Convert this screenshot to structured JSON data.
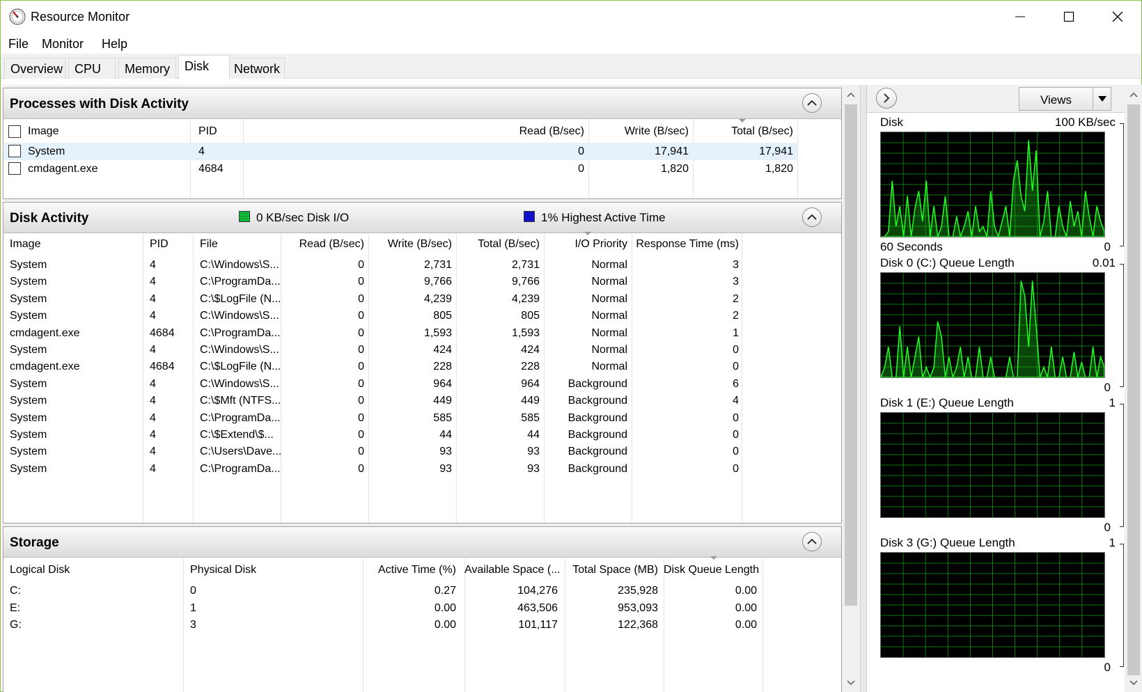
{
  "window": {
    "title": "Resource Monitor"
  },
  "menu": [
    "File",
    "Monitor",
    "Help"
  ],
  "tabs": [
    "Overview",
    "CPU",
    "Memory",
    "Disk",
    "Network"
  ],
  "active_tab": "Disk",
  "processes": {
    "title": "Processes with Disk Activity",
    "columns": {
      "image": "Image",
      "pid": "PID",
      "read": "Read (B/sec)",
      "write": "Write (B/sec)",
      "total": "Total (B/sec)"
    },
    "rows": [
      {
        "image": "System",
        "pid": "4",
        "read": "0",
        "write": "17,941",
        "total": "17,941"
      },
      {
        "image": "cmdagent.exe",
        "pid": "4684",
        "read": "0",
        "write": "1,820",
        "total": "1,820"
      }
    ]
  },
  "disk_activity": {
    "title": "Disk Activity",
    "io_label": "0 KB/sec Disk I/O",
    "active_label": "1% Highest Active Time",
    "io_color": "#1e9e1e",
    "active_color": "#1111cc",
    "columns": {
      "image": "Image",
      "pid": "PID",
      "file": "File",
      "read": "Read (B/sec)",
      "write": "Write (B/sec)",
      "total": "Total (B/sec)",
      "priority": "I/O Priority",
      "response": "Response Time (ms)"
    },
    "rows": [
      {
        "image": "System",
        "pid": "4",
        "file": "C:\\Windows\\S...",
        "read": "0",
        "write": "2,731",
        "total": "2,731",
        "priority": "Normal",
        "response": "3"
      },
      {
        "image": "System",
        "pid": "4",
        "file": "C:\\ProgramDa...",
        "read": "0",
        "write": "9,766",
        "total": "9,766",
        "priority": "Normal",
        "response": "3"
      },
      {
        "image": "System",
        "pid": "4",
        "file": "C:\\$LogFile (N...",
        "read": "0",
        "write": "4,239",
        "total": "4,239",
        "priority": "Normal",
        "response": "2"
      },
      {
        "image": "System",
        "pid": "4",
        "file": "C:\\Windows\\S...",
        "read": "0",
        "write": "805",
        "total": "805",
        "priority": "Normal",
        "response": "2"
      },
      {
        "image": "cmdagent.exe",
        "pid": "4684",
        "file": "C:\\ProgramDa...",
        "read": "0",
        "write": "1,593",
        "total": "1,593",
        "priority": "Normal",
        "response": "1"
      },
      {
        "image": "System",
        "pid": "4",
        "file": "C:\\Windows\\S...",
        "read": "0",
        "write": "424",
        "total": "424",
        "priority": "Normal",
        "response": "0"
      },
      {
        "image": "cmdagent.exe",
        "pid": "4684",
        "file": "C:\\$LogFile (N...",
        "read": "0",
        "write": "228",
        "total": "228",
        "priority": "Normal",
        "response": "0"
      },
      {
        "image": "System",
        "pid": "4",
        "file": "C:\\Windows\\S...",
        "read": "0",
        "write": "964",
        "total": "964",
        "priority": "Background",
        "response": "6"
      },
      {
        "image": "System",
        "pid": "4",
        "file": "C:\\$Mft (NTFS...",
        "read": "0",
        "write": "449",
        "total": "449",
        "priority": "Background",
        "response": "4"
      },
      {
        "image": "System",
        "pid": "4",
        "file": "C:\\ProgramDa...",
        "read": "0",
        "write": "585",
        "total": "585",
        "priority": "Background",
        "response": "0"
      },
      {
        "image": "System",
        "pid": "4",
        "file": "C:\\$Extend\\$...",
        "read": "0",
        "write": "44",
        "total": "44",
        "priority": "Background",
        "response": "0"
      },
      {
        "image": "System",
        "pid": "4",
        "file": "C:\\Users\\Dave...",
        "read": "0",
        "write": "93",
        "total": "93",
        "priority": "Background",
        "response": "0"
      },
      {
        "image": "System",
        "pid": "4",
        "file": "C:\\ProgramDa...",
        "read": "0",
        "write": "93",
        "total": "93",
        "priority": "Background",
        "response": "0"
      }
    ]
  },
  "storage": {
    "title": "Storage",
    "columns": {
      "logical": "Logical Disk",
      "physical": "Physical Disk",
      "active": "Active Time (%)",
      "available": "Available Space (...",
      "total": "Total Space (MB)",
      "queue": "Disk Queue Length"
    },
    "rows": [
      {
        "logical": "C:",
        "physical": "0",
        "active": "0.27",
        "available": "104,276",
        "total": "235,928",
        "queue": "0.00"
      },
      {
        "logical": "E:",
        "physical": "1",
        "active": "0.00",
        "available": "463,506",
        "total": "953,093",
        "queue": "0.00"
      },
      {
        "logical": "G:",
        "physical": "3",
        "active": "0.00",
        "available": "101,117",
        "total": "122,368",
        "queue": "0.00"
      }
    ]
  },
  "right_panel": {
    "views_label": "Views",
    "graphs": [
      {
        "title": "Disk",
        "max": "100 KB/sec",
        "footer_left": "60 Seconds",
        "footer_right": "0",
        "values": [
          0,
          0,
          0.05,
          0.55,
          0.1,
          0.3,
          0,
          0.4,
          0,
          0.28,
          0.45,
          0.15,
          0.55,
          0,
          0.3,
          0,
          0.1,
          0.4,
          0,
          0,
          0.2,
          0,
          0.1,
          0.25,
          0,
          0.3,
          0.05,
          0.1,
          0,
          0.45,
          0.1,
          0,
          0.15,
          0.3,
          0,
          0.55,
          0.75,
          0.4,
          0.25,
          0.95,
          0.45,
          0.85,
          0,
          0.15,
          0.45,
          0,
          0,
          0.3,
          0.1,
          0,
          0.35,
          0.1,
          0.25,
          0,
          0.45,
          0.2,
          0,
          0.3,
          0.15,
          0.05
        ]
      },
      {
        "title": "Disk 0 (C:) Queue Length",
        "max": "0.01",
        "footer_left": "",
        "footer_right": "0",
        "values": [
          0,
          0.1,
          0.3,
          0,
          0,
          0.5,
          0,
          0.3,
          0,
          0.2,
          0.4,
          0,
          0.1,
          0,
          0.1,
          0.55,
          0.4,
          0,
          0.2,
          0,
          0.1,
          0.3,
          0,
          0.2,
          0,
          0,
          0.3,
          0,
          0,
          0.2,
          0,
          0,
          0,
          0,
          0.2,
          0,
          0,
          0.95,
          0.8,
          0.3,
          0.95,
          0.5,
          0,
          0.1,
          0,
          0.3,
          0,
          0,
          0.2,
          0,
          0,
          0.25,
          0,
          0.15,
          0,
          0,
          0.3,
          0,
          0.2,
          0.1
        ]
      },
      {
        "title": "Disk 1 (E:) Queue Length",
        "max": "1",
        "footer_left": "",
        "footer_right": "0",
        "values": []
      },
      {
        "title": "Disk 3 (G:) Queue Length",
        "max": "1",
        "footer_left": "",
        "footer_right": "0",
        "values": []
      }
    ]
  }
}
